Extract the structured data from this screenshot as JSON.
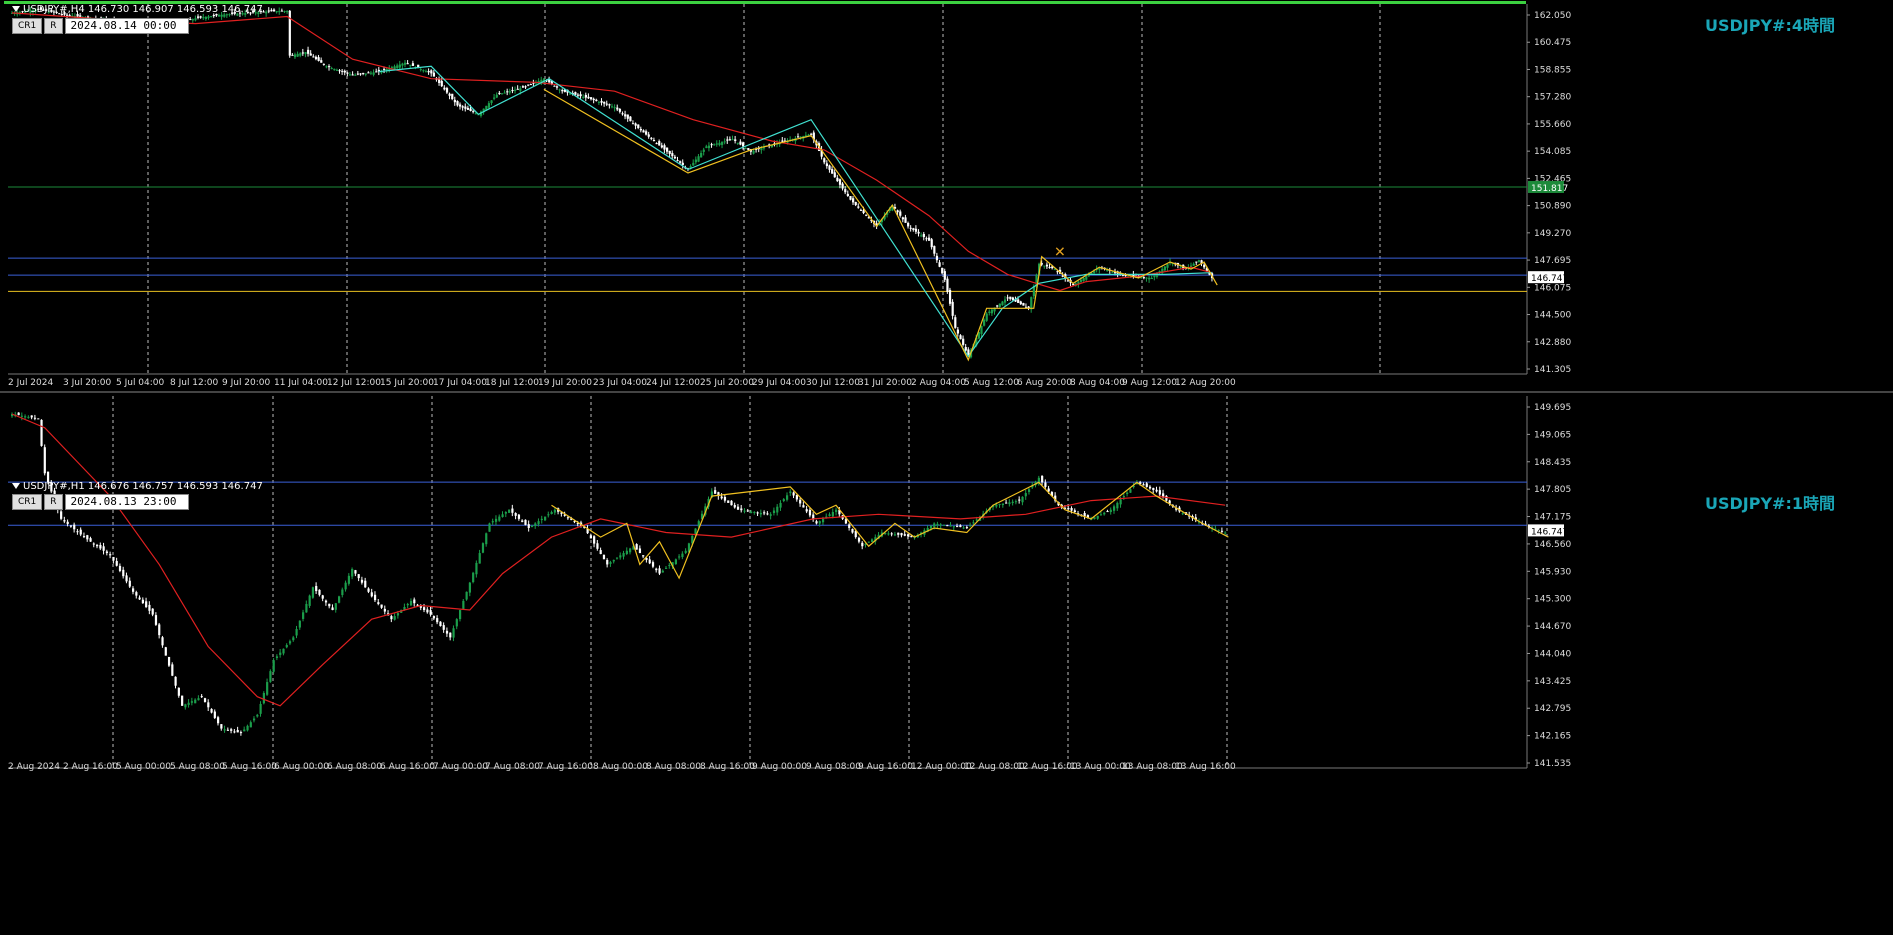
{
  "panels": [
    {
      "header": "USDJPY#,H4  146.730 146.907 146.593 146.747",
      "buttons": [
        "CR1",
        "R"
      ],
      "date_box": "2024.08.14 00:00",
      "title": "USDJPY#:4時間",
      "current_price_label": "146.747",
      "green_line_label": "151.817"
    },
    {
      "header": "USDJPY#,H1  146.676 146.757 146.593 146.747",
      "buttons": [
        "CR1",
        "R"
      ],
      "date_box": "2024.08.13 23:00",
      "title": "USDJPY#:1時間",
      "current_price_label": "146.747"
    }
  ],
  "chart_data": [
    {
      "type": "candlestick",
      "title": "USDJPY#:4時間",
      "timeframe": "H4",
      "ohlc_last": {
        "open": 146.73,
        "high": 146.907,
        "low": 146.593,
        "close": 146.747
      },
      "ylim": [
        141.305,
        162.1
      ],
      "y_ticks": [
        "162.050",
        "160.475",
        "158.855",
        "157.280",
        "155.660",
        "154.085",
        "152.465",
        "150.890",
        "149.270",
        "147.695",
        "146.075",
        "144.500",
        "142.880",
        "141.305"
      ],
      "x_ticks": [
        "2 Jul 2024",
        "3 Jul 20:00",
        "5 Jul 04:00",
        "8 Jul 12:00",
        "9 Jul 20:00",
        "11 Jul 04:00",
        "12 Jul 12:00",
        "15 Jul 20:00",
        "17 Jul 04:00",
        "18 Jul 12:00",
        "19 Jul 20:00",
        "23 Jul 04:00",
        "24 Jul 12:00",
        "25 Jul 20:00",
        "29 Jul 04:00",
        "30 Jul 12:00",
        "31 Jul 20:00",
        "2 Aug 04:00",
        "5 Aug 12:00",
        "6 Aug 20:00",
        "8 Aug 04:00",
        "9 Aug 12:00",
        "12 Aug 20:00"
      ],
      "price_path": [
        [
          0,
          161.6
        ],
        [
          10,
          161.8
        ],
        [
          20,
          161.5
        ],
        [
          30,
          161.3
        ],
        [
          40,
          161.1
        ],
        [
          50,
          161.0
        ],
        [
          60,
          160.8
        ],
        [
          70,
          161.3
        ],
        [
          80,
          161.5
        ],
        [
          90,
          161.6
        ],
        [
          100,
          161.7
        ],
        [
          105,
          161.7
        ],
        [
          106,
          159.2
        ],
        [
          112,
          159.4
        ],
        [
          120,
          158.6
        ],
        [
          130,
          158.1
        ],
        [
          140,
          158.3
        ],
        [
          150,
          158.8
        ],
        [
          160,
          158.2
        ],
        [
          170,
          156.4
        ],
        [
          178,
          155.9
        ],
        [
          185,
          157.0
        ],
        [
          195,
          157.4
        ],
        [
          203,
          157.9
        ],
        [
          210,
          157.2
        ],
        [
          220,
          156.8
        ],
        [
          230,
          156.3
        ],
        [
          240,
          155.0
        ],
        [
          250,
          153.8
        ],
        [
          258,
          152.8
        ],
        [
          265,
          154.1
        ],
        [
          275,
          154.5
        ],
        [
          282,
          153.8
        ],
        [
          290,
          154.2
        ],
        [
          300,
          154.6
        ],
        [
          305,
          154.8
        ],
        [
          310,
          153.2
        ],
        [
          320,
          151.1
        ],
        [
          330,
          149.6
        ],
        [
          336,
          150.8
        ],
        [
          342,
          149.6
        ],
        [
          350,
          148.8
        ],
        [
          356,
          146.6
        ],
        [
          360,
          143.9
        ],
        [
          365,
          142.3
        ],
        [
          372,
          144.7
        ],
        [
          380,
          145.6
        ],
        [
          388,
          145.0
        ],
        [
          392,
          147.5
        ],
        [
          398,
          147.2
        ],
        [
          405,
          146.3
        ],
        [
          415,
          147.3
        ],
        [
          425,
          146.8
        ],
        [
          435,
          146.7
        ],
        [
          442,
          147.6
        ],
        [
          448,
          147.2
        ],
        [
          453,
          147.7
        ],
        [
          458,
          146.7
        ]
      ],
      "ma_red_path": [
        [
          0,
          161.6
        ],
        [
          40,
          161.2
        ],
        [
          70,
          161.0
        ],
        [
          105,
          161.4
        ],
        [
          130,
          159.0
        ],
        [
          160,
          157.9
        ],
        [
          200,
          157.7
        ],
        [
          230,
          157.2
        ],
        [
          260,
          155.6
        ],
        [
          290,
          154.4
        ],
        [
          310,
          153.9
        ],
        [
          330,
          152.2
        ],
        [
          350,
          150.2
        ],
        [
          365,
          148.2
        ],
        [
          380,
          146.9
        ],
        [
          393,
          146.3
        ],
        [
          400,
          146.0
        ],
        [
          410,
          146.5
        ],
        [
          430,
          146.8
        ],
        [
          450,
          147.3
        ],
        [
          458,
          147.0
        ]
      ],
      "zigzag_cyan_path": [
        [
          140,
          158.3
        ],
        [
          160,
          158.6
        ],
        [
          178,
          155.9
        ],
        [
          205,
          157.9
        ],
        [
          258,
          152.8
        ],
        [
          305,
          155.6
        ],
        [
          365,
          142.3
        ],
        [
          378,
          145.0
        ],
        [
          392,
          146.4
        ],
        [
          410,
          146.9
        ],
        [
          440,
          146.9
        ],
        [
          458,
          147.0
        ]
      ],
      "zigzag_yellow_path": [
        [
          203,
          157.3
        ],
        [
          258,
          152.6
        ],
        [
          282,
          153.9
        ],
        [
          305,
          154.7
        ],
        [
          330,
          149.6
        ],
        [
          336,
          150.8
        ],
        [
          365,
          142.1
        ],
        [
          372,
          145.0
        ],
        [
          390,
          145.0
        ],
        [
          393,
          147.9
        ],
        [
          405,
          146.4
        ],
        [
          415,
          147.3
        ],
        [
          430,
          146.7
        ],
        [
          442,
          147.6
        ],
        [
          450,
          147.2
        ],
        [
          455,
          147.6
        ],
        [
          460,
          146.3
        ]
      ],
      "horizontal_lines": [
        {
          "price": 151.817,
          "color": "#1c8a3a"
        },
        {
          "price": 147.82,
          "color": "#3a5fd8"
        },
        {
          "price": 146.86,
          "color": "#3a5fd8"
        },
        {
          "price": 145.95,
          "color": "#e8c020"
        }
      ],
      "last_price": 146.747,
      "grid": "vertical-dashed",
      "colors": {
        "bull": "#1b9e4b",
        "bear": "#ffffff",
        "ma": "#e02020",
        "zigzag1": "#40e0d0",
        "zigzag2": "#f0c020",
        "title": "#1aa6b7",
        "frame": "#3cd040"
      }
    },
    {
      "type": "candlestick",
      "title": "USDJPY#:1時間",
      "timeframe": "H1",
      "ohlc_last": {
        "open": 146.676,
        "high": 146.757,
        "low": 146.593,
        "close": 146.747
      },
      "ylim": [
        141.535,
        149.695
      ],
      "y_ticks": [
        "149.695",
        "149.065",
        "148.435",
        "147.805",
        "147.175",
        "146.560",
        "145.930",
        "145.300",
        "144.670",
        "144.040",
        "143.425",
        "142.795",
        "142.165",
        "141.535"
      ],
      "x_ticks": [
        "2 Aug 2024",
        "2 Aug 16:00",
        "5 Aug 00:00",
        "5 Aug 08:00",
        "5 Aug 16:00",
        "6 Aug 00:00",
        "6 Aug 08:00",
        "6 Aug 16:00",
        "7 Aug 00:00",
        "7 Aug 08:00",
        "7 Aug 16:00",
        "8 Aug 00:00",
        "8 Aug 08:00",
        "8 Aug 16:00",
        "9 Aug 00:00",
        "9 Aug 08:00",
        "9 Aug 16:00",
        "12 Aug 00:00",
        "12 Aug 08:00",
        "12 Aug 16:00",
        "13 Aug 00:00",
        "13 Aug 08:00",
        "13 Aug 16:00"
      ],
      "price_path": [
        [
          0,
          149.3
        ],
        [
          8,
          149.2
        ],
        [
          10,
          148.0
        ],
        [
          15,
          147.0
        ],
        [
          22,
          146.6
        ],
        [
          30,
          146.2
        ],
        [
          37,
          145.4
        ],
        [
          43,
          144.9
        ],
        [
          47,
          144.0
        ],
        [
          52,
          142.9
        ],
        [
          58,
          143.1
        ],
        [
          64,
          142.4
        ],
        [
          70,
          142.3
        ],
        [
          75,
          142.7
        ],
        [
          80,
          143.9
        ],
        [
          86,
          144.4
        ],
        [
          92,
          145.5
        ],
        [
          98,
          145.0
        ],
        [
          104,
          145.9
        ],
        [
          110,
          145.3
        ],
        [
          116,
          144.8
        ],
        [
          122,
          145.2
        ],
        [
          128,
          144.9
        ],
        [
          134,
          144.4
        ],
        [
          140,
          145.6
        ],
        [
          146,
          146.9
        ],
        [
          152,
          147.2
        ],
        [
          158,
          146.8
        ],
        [
          166,
          147.2
        ],
        [
          175,
          146.8
        ],
        [
          182,
          146.0
        ],
        [
          190,
          146.4
        ],
        [
          198,
          145.8
        ],
        [
          206,
          146.3
        ],
        [
          214,
          147.6
        ],
        [
          222,
          147.2
        ],
        [
          232,
          147.1
        ],
        [
          238,
          147.6
        ],
        [
          246,
          146.9
        ],
        [
          252,
          147.2
        ],
        [
          260,
          146.4
        ],
        [
          266,
          146.7
        ],
        [
          276,
          146.6
        ],
        [
          282,
          146.9
        ],
        [
          292,
          146.8
        ],
        [
          300,
          147.3
        ],
        [
          308,
          147.4
        ],
        [
          314,
          147.9
        ],
        [
          320,
          147.3
        ],
        [
          330,
          147.0
        ],
        [
          336,
          147.2
        ],
        [
          344,
          147.8
        ],
        [
          350,
          147.6
        ],
        [
          356,
          147.2
        ],
        [
          364,
          146.9
        ],
        [
          371,
          146.7
        ]
      ],
      "ma_red_path": [
        [
          0,
          149.3
        ],
        [
          10,
          149.0
        ],
        [
          30,
          147.5
        ],
        [
          45,
          146.0
        ],
        [
          60,
          144.2
        ],
        [
          75,
          143.1
        ],
        [
          82,
          142.9
        ],
        [
          95,
          143.8
        ],
        [
          110,
          144.8
        ],
        [
          125,
          145.1
        ],
        [
          140,
          145.0
        ],
        [
          150,
          145.8
        ],
        [
          165,
          146.6
        ],
        [
          180,
          147.0
        ],
        [
          200,
          146.7
        ],
        [
          220,
          146.6
        ],
        [
          245,
          147.0
        ],
        [
          265,
          147.1
        ],
        [
          290,
          147.0
        ],
        [
          310,
          147.1
        ],
        [
          330,
          147.4
        ],
        [
          350,
          147.5
        ],
        [
          371,
          147.3
        ]
      ],
      "zigzag_yellow_path": [
        [
          165,
          147.3
        ],
        [
          180,
          146.6
        ],
        [
          188,
          146.9
        ],
        [
          192,
          146.0
        ],
        [
          198,
          146.5
        ],
        [
          204,
          145.7
        ],
        [
          214,
          147.5
        ],
        [
          238,
          147.7
        ],
        [
          246,
          147.1
        ],
        [
          252,
          147.3
        ],
        [
          262,
          146.4
        ],
        [
          270,
          146.9
        ],
        [
          276,
          146.6
        ],
        [
          282,
          146.8
        ],
        [
          292,
          146.7
        ],
        [
          300,
          147.3
        ],
        [
          314,
          147.8
        ],
        [
          322,
          147.2
        ],
        [
          330,
          147.0
        ],
        [
          344,
          147.8
        ],
        [
          350,
          147.5
        ],
        [
          364,
          146.9
        ],
        [
          372,
          146.6
        ]
      ],
      "horizontal_lines": [
        {
          "price": 147.805,
          "color": "#3a5fd8"
        },
        {
          "price": 146.86,
          "color": "#3a5fd8"
        }
      ],
      "last_price": 146.747,
      "grid": "vertical-dashed",
      "colors": {
        "bull": "#1b9e4b",
        "bear": "#ffffff",
        "ma": "#e02020",
        "zigzag": "#f0c020",
        "title": "#1aa6b7"
      }
    }
  ]
}
